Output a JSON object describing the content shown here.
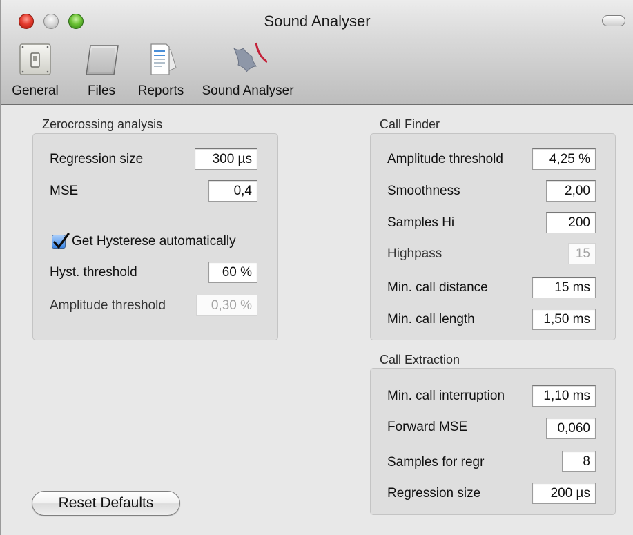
{
  "window": {
    "title": "Sound Analyser"
  },
  "toolbar": {
    "items": [
      {
        "label": "General",
        "icon": "switch-icon"
      },
      {
        "label": "Files",
        "icon": "folder-icon"
      },
      {
        "label": "Reports",
        "icon": "document-icon"
      },
      {
        "label": "Sound Analyser",
        "icon": "bat-icon"
      }
    ]
  },
  "zerocrossing": {
    "title": "Zerocrossing analysis",
    "regression_size": {
      "label": "Regression size",
      "value": "300 µs"
    },
    "mse": {
      "label": "MSE",
      "value": "0,4"
    },
    "hysterese_auto": {
      "label": "Get Hysterese automatically",
      "checked": true
    },
    "hyst_threshold": {
      "label": "Hyst. threshold",
      "value": "60 %"
    },
    "amplitude_threshold": {
      "label": "Amplitude threshold",
      "value": "0,30 %",
      "enabled": false
    }
  },
  "call_finder": {
    "title": "Call Finder",
    "amplitude_threshold": {
      "label": "Amplitude threshold",
      "value": "4,25 %"
    },
    "smoothness": {
      "label": "Smoothness",
      "value": "2,00"
    },
    "samples_hi": {
      "label": "Samples Hi",
      "value": "200"
    },
    "highpass": {
      "label": "Highpass",
      "value": "15",
      "enabled": false
    },
    "min_call_distance": {
      "label": "Min. call distance",
      "value": "15 ms"
    },
    "min_call_length": {
      "label": "Min. call length",
      "value": "1,50 ms"
    }
  },
  "call_extraction": {
    "title": "Call Extraction",
    "min_call_interruption": {
      "label": "Min. call interruption",
      "value": "1,10 ms"
    },
    "forward_mse": {
      "label": "Forward MSE",
      "value": "0,060"
    },
    "samples_for_regr": {
      "label": "Samples for regr",
      "value": "8"
    },
    "regression_size": {
      "label": "Regression size",
      "value": "200 µs"
    }
  },
  "reset_button": {
    "label": "Reset Defaults"
  },
  "colors": {
    "accent": "#3a86e8",
    "close": "#e53d30",
    "zoom": "#6cc236"
  }
}
